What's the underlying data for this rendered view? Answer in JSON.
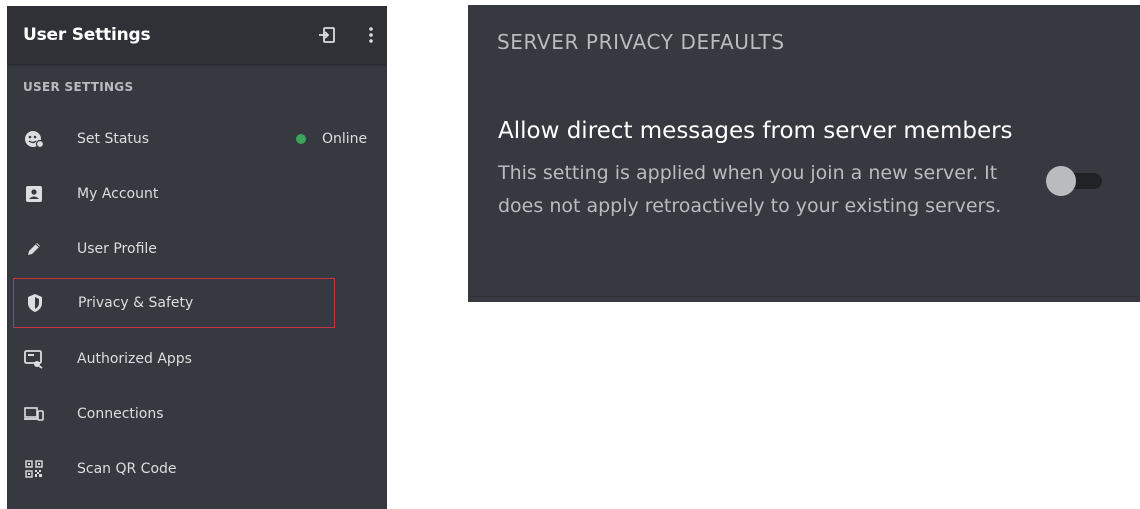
{
  "sidebar": {
    "header_title": "User Settings",
    "section_label": "USER SETTINGS",
    "items": [
      {
        "label": "Set Status",
        "icon": "emoji-status-icon"
      },
      {
        "label": "My Account",
        "icon": "id-card-icon"
      },
      {
        "label": "User Profile",
        "icon": "pencil-icon"
      },
      {
        "label": "Privacy & Safety",
        "icon": "shield-icon"
      },
      {
        "label": "Authorized Apps",
        "icon": "authorized-apps-icon"
      },
      {
        "label": "Connections",
        "icon": "devices-icon"
      },
      {
        "label": "Scan QR Code",
        "icon": "qr-code-icon"
      }
    ],
    "status_value": "Online",
    "highlighted_item": "Privacy & Safety"
  },
  "privacy": {
    "section_title": "SERVER PRIVACY DEFAULTS",
    "setting_title": "Allow direct messages from server members",
    "setting_description": "This setting is applied when you join a new server. It does not apply retroactively to your existing servers.",
    "toggle_on": false
  },
  "colors": {
    "background": "#36393f",
    "header": "#2f3136",
    "status_online": "#3ba55d",
    "highlight_border": "#c8363d"
  }
}
